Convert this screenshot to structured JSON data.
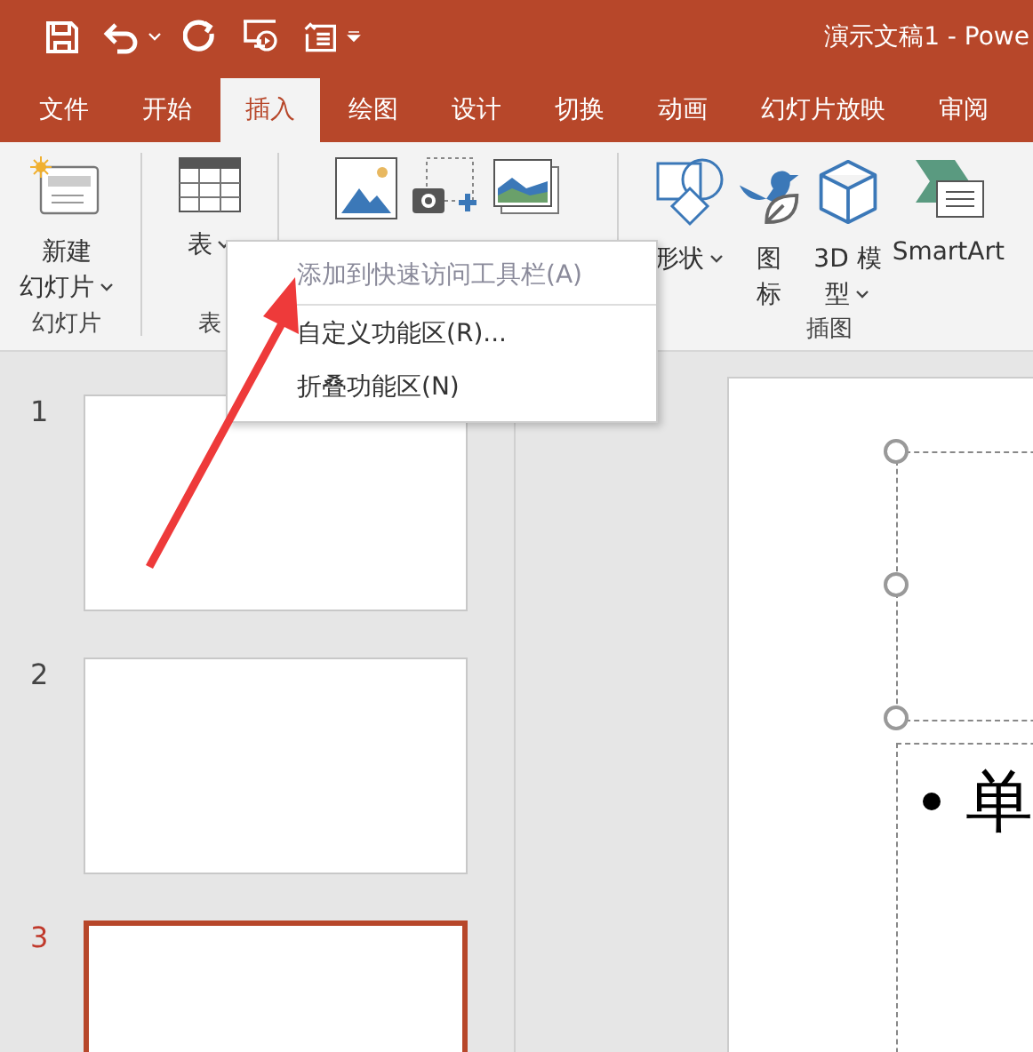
{
  "window": {
    "title": "演示文稿1  -  Powe"
  },
  "tabs": [
    {
      "label": "文件",
      "selected": false
    },
    {
      "label": "开始",
      "selected": false
    },
    {
      "label": "插入",
      "selected": true
    },
    {
      "label": "绘图",
      "selected": false
    },
    {
      "label": "设计",
      "selected": false
    },
    {
      "label": "切换",
      "selected": false
    },
    {
      "label": "动画",
      "selected": false
    },
    {
      "label": "幻灯片放映",
      "selected": false
    },
    {
      "label": "审阅",
      "selected": false
    }
  ],
  "ribbon": {
    "groups": [
      {
        "label": "幻灯片",
        "items": [
          {
            "kind": "new-slide",
            "lines": [
              "新建",
              "幻灯片"
            ],
            "dropdown": true
          }
        ]
      },
      {
        "label": "表",
        "items": [
          {
            "kind": "table",
            "lines": [
              "表"
            ],
            "dropdown": true
          }
        ]
      },
      {
        "items": [
          {
            "kind": "picture"
          },
          {
            "kind": "screenshot"
          },
          {
            "kind": "album"
          }
        ]
      },
      {
        "label": "插图",
        "items": [
          {
            "kind": "shapes",
            "lines": [
              "形状"
            ],
            "dropdown": true
          },
          {
            "kind": "icons",
            "lines": [
              "图",
              "标"
            ],
            "dropdown": false
          },
          {
            "kind": "model",
            "lines": [
              "3D 模",
              "型"
            ],
            "dropdown": true
          },
          {
            "kind": "smartart",
            "lines": [
              "SmartArt"
            ],
            "dropdown": false
          }
        ]
      }
    ]
  },
  "context_menu": {
    "items": [
      {
        "label": "添加到快速访问工具栏(A)",
        "disabled": true,
        "separator_after": true
      },
      {
        "label": "自定义功能区(R)...",
        "disabled": false,
        "separator_after": false
      },
      {
        "label": "折叠功能区(N)",
        "disabled": false,
        "separator_after": false
      }
    ]
  },
  "slides": [
    {
      "number": "1",
      "selected": false
    },
    {
      "number": "2",
      "selected": false
    },
    {
      "number": "3",
      "selected": true
    }
  ],
  "editor": {
    "bullets": [
      "单"
    ]
  }
}
